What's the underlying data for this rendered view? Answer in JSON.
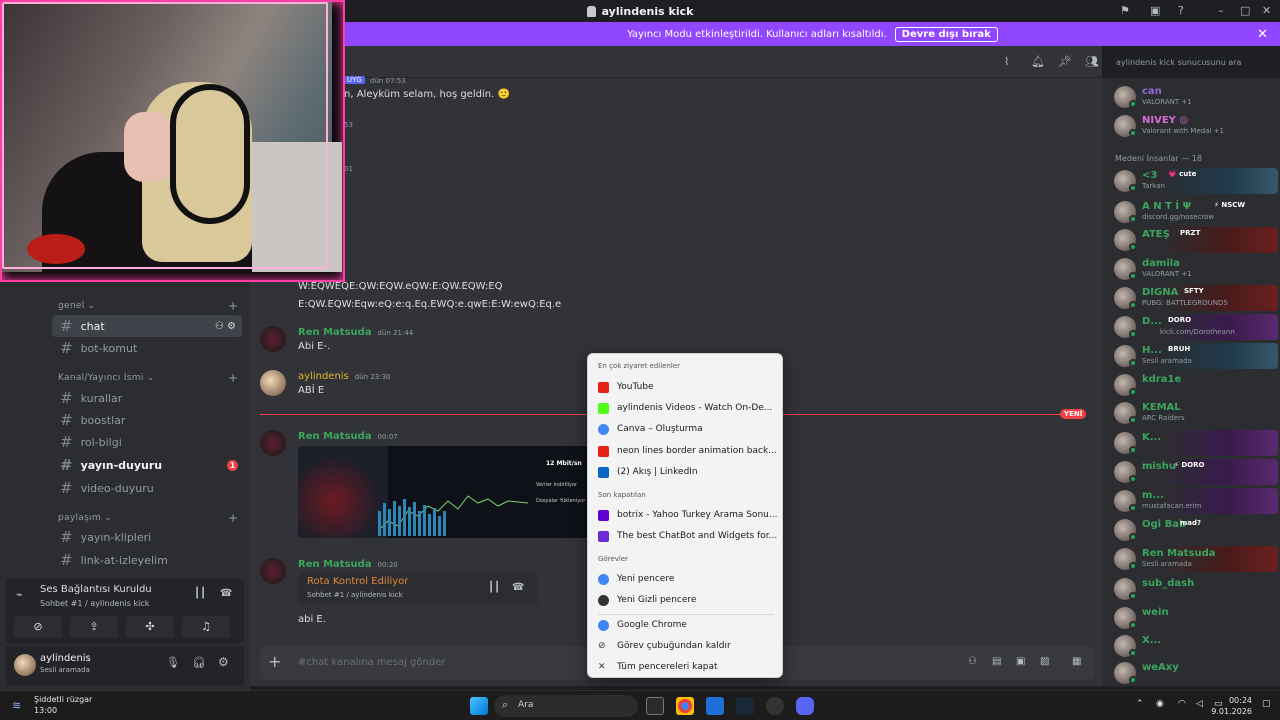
{
  "window": {
    "title": "aylindenis kick"
  },
  "banner": {
    "text": "Yayıncı Modu etkinleştirildi. Kullanıcı adları kısaltıldı.",
    "button": "Devre dışı bırak"
  },
  "search": {
    "placeholder": "aylindenis kick sunucusunu ara"
  },
  "sidebar": {
    "categories": [
      {
        "name": "genel ⌄",
        "channels": [
          "chat",
          "bot-komut"
        ]
      },
      {
        "name": "Kanal/Yayıncı İsmi ⌄",
        "channels": [
          "kurallar",
          "boostlar",
          "rol-bilgi",
          "yayın-duyuru",
          "video-duyuru"
        ]
      },
      {
        "name": "paylaşım ⌄",
        "channels": [
          "yayın-klipleri",
          "link-at-izleyelim"
        ]
      }
    ],
    "unread_badge": "1",
    "voice": {
      "title": "Ses Bağlantısı Kuruldu",
      "subtitle": "Sohbet #1 / aylindenis kick"
    },
    "user": {
      "name": "aylindenis",
      "status": "Sesli aramada"
    }
  },
  "messages": [
    {
      "tag": "UYG",
      "time": "dün 07:53",
      "text": "n, Aleyküm selam, hoş geldin. 🙂"
    },
    {
      "time_a": "53",
      "time_b": "01"
    },
    {
      "text": "W:EQWEQE:QW:EQW.eQW:E:QW.EQW:EQ"
    },
    {
      "text": "E:QW.EQW:Eqw:eQ:e:q.Eq.EWQ:e.qwE:E:W:ewQ:Eq.e"
    },
    {
      "name": "Ren Matsuda",
      "time": "dün 21:44",
      "text": "Abi E-."
    },
    {
      "name": "aylindenis",
      "time": "dün 23:30",
      "text": "ABİ E"
    },
    {
      "name": "Ren Matsuda",
      "time": "00:07",
      "embed": {
        "speed": "12 Mbit/sn",
        "label1": "Veriler indiriliyor",
        "label2": "Dosyalar Yükleniyor"
      }
    },
    {
      "name": "Ren Matsuda",
      "time": "00:20",
      "rota": {
        "title": "Rota Kontrol Ediliyor",
        "subtitle": "Sohbet #1 / aylindenis kick"
      },
      "text": "abi E."
    }
  ],
  "new_label": "YENİ",
  "composer": {
    "placeholder": "#chat kanalına mesaj gönder"
  },
  "members": {
    "top": [
      {
        "name": "can",
        "sub": "VALORANT +1"
      },
      {
        "name": "NIVEY ◎",
        "sub": "Valorant with Medal +1"
      }
    ],
    "section": "Medeni İnsanlar — 18",
    "list": [
      {
        "name": "<3",
        "tag": "💗 cute",
        "sub": "Tarkan"
      },
      {
        "name": "A N T İ Ψ",
        "tag": "⚡ NSCW",
        "sub": "discord.gg/nosecrow"
      },
      {
        "name": "ATEŞ",
        "tag": "PRZT",
        "sub": ""
      },
      {
        "name": "damila",
        "tag": "",
        "sub": "VALORANT +1"
      },
      {
        "name": "DIGNA",
        "tag": "SFTY",
        "sub": "PUBG: BATTLEGROUNDS"
      },
      {
        "name": "D...",
        "tag": "DORO",
        "sub": "kick.com/Dorotheann"
      },
      {
        "name": "H...",
        "tag": "BRUH",
        "sub": "Sesli aramada"
      },
      {
        "name": "kdra1e",
        "tag": "",
        "sub": ""
      },
      {
        "name": "KEMAL",
        "tag": "",
        "sub": "ARC Raiders"
      },
      {
        "name": "K...",
        "tag": "",
        "sub": ""
      },
      {
        "name": "mishu",
        "tag": "⚡ DORO",
        "sub": ""
      },
      {
        "name": "m...",
        "tag": "",
        "sub": "mustafacan.erim"
      },
      {
        "name": "Ogi Bab",
        "tag": "mad?",
        "sub": ""
      },
      {
        "name": "Ren Matsuda",
        "tag": "",
        "sub": "Sesli aramada"
      },
      {
        "name": "sub_dash",
        "tag": "",
        "sub": ""
      },
      {
        "name": "wein",
        "tag": "",
        "sub": ""
      },
      {
        "name": "X...",
        "tag": "",
        "sub": ""
      },
      {
        "name": "weAxy",
        "tag": "",
        "sub": ""
      }
    ]
  },
  "jumplist": {
    "frequent_title": "En çok ziyaret edilenler",
    "frequent": [
      "YouTube",
      "aylindenis Videos - Watch On-De...",
      "Canva – Oluşturma",
      "neon lines border animation back...",
      "(2) Akış | LinkedIn"
    ],
    "recent_title": "Son kapatılan",
    "recent": [
      "botrix - Yahoo Turkey Arama Sonu...",
      "The best ChatBot and Widgets for..."
    ],
    "tasks_title": "Görevler",
    "tasks": [
      "Yeni pencere",
      "Yeni Gizli pencere"
    ],
    "app": [
      "Google Chrome",
      "Görev çubuğundan kaldır",
      "Tüm pencereleri kapat"
    ]
  },
  "taskbar": {
    "weather_title": "Şiddetli rüzgar",
    "weather_time": "13:00",
    "search": "Ara",
    "time": "00:24",
    "date": "9.01.2026"
  },
  "colors": {
    "accent": "#9147ff",
    "ren": "#3ba55d",
    "ayl": "#e0b62b",
    "unread": "#f23f43"
  }
}
